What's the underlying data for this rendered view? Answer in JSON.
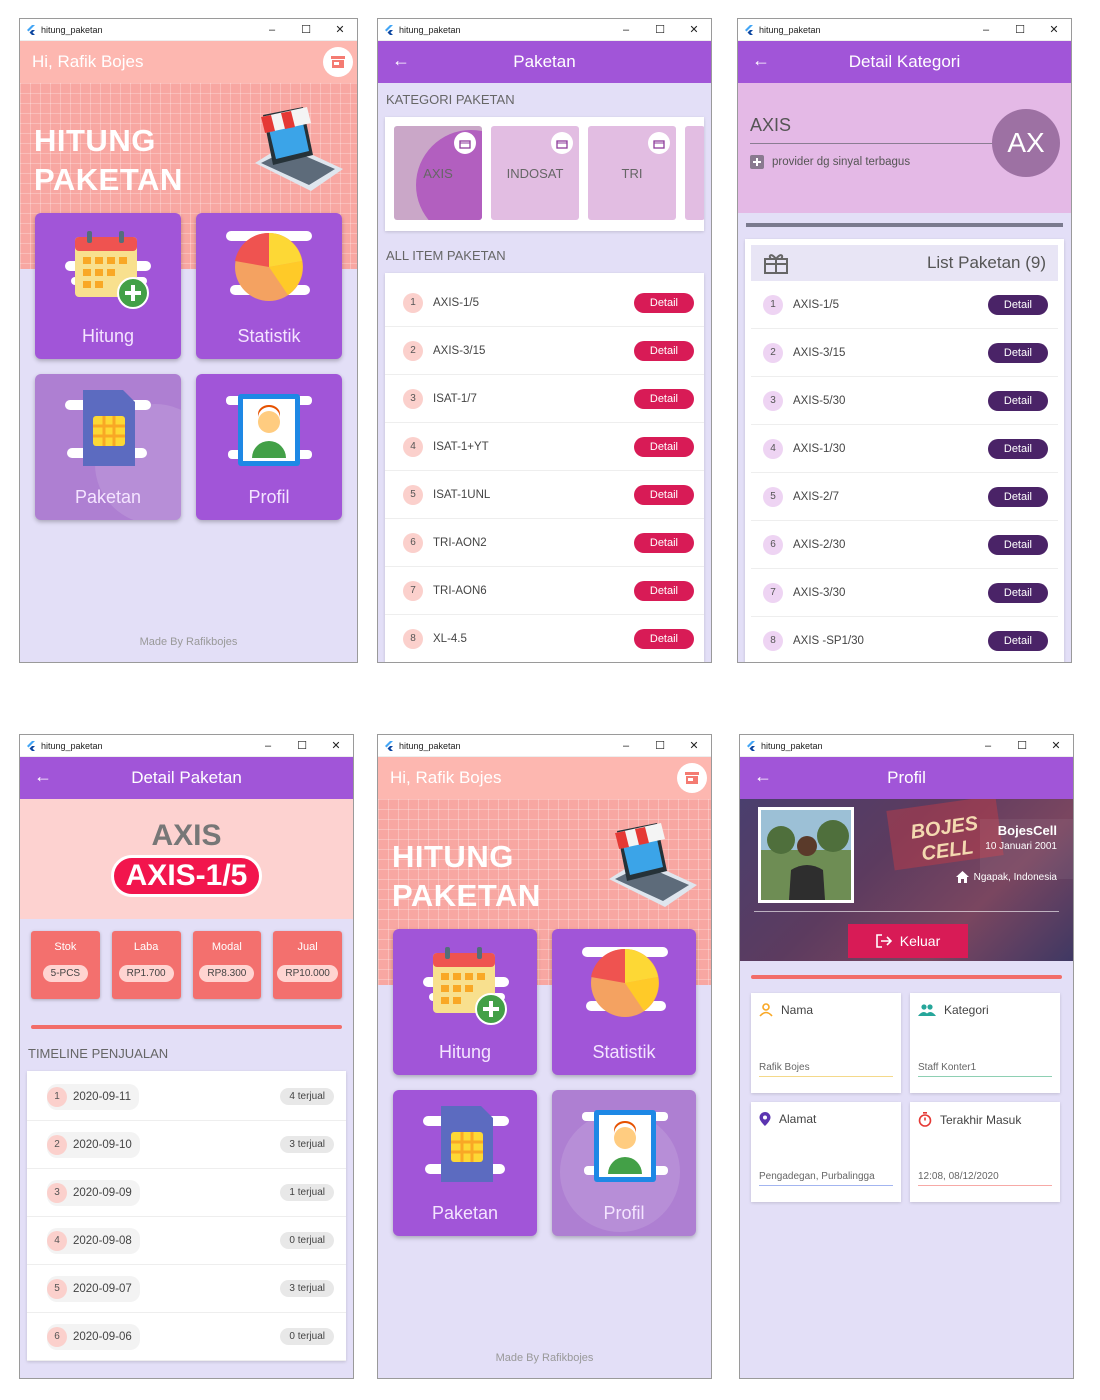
{
  "window": {
    "title": "hitung_paketan"
  },
  "home": {
    "greeting": "Hi, Rafik Bojes",
    "hero_line1": "HITUNG",
    "hero_line2": "PAKETAN",
    "tile_hitung": "Hitung",
    "tile_statistik": "Statistik",
    "tile_paketan": "Paketan",
    "tile_profil": "Profil",
    "made_by": "Made By Rafikbojes"
  },
  "paketan": {
    "title": "Paketan",
    "kategori_header": "KATEGORI PAKETAN",
    "categories": [
      "AXIS",
      "INDOSAT",
      "TRI"
    ],
    "items_header": "ALL ITEM PAKETAN",
    "items": [
      {
        "no": "1",
        "name": "AXIS-1/5"
      },
      {
        "no": "2",
        "name": "AXIS-3/15"
      },
      {
        "no": "3",
        "name": "ISAT-1/7"
      },
      {
        "no": "4",
        "name": "ISAT-1+YT"
      },
      {
        "no": "5",
        "name": "ISAT-1UNL"
      },
      {
        "no": "6",
        "name": "TRI-AON2"
      },
      {
        "no": "7",
        "name": "TRI-AON6"
      },
      {
        "no": "8",
        "name": "XL-4.5"
      }
    ],
    "detail_label": "Detail"
  },
  "kategori": {
    "title": "Detail Kategori",
    "name": "AXIS",
    "desc": "provider dg sinyal terbagus",
    "avatar": "AX",
    "list_title": "List Paketan (9)",
    "items": [
      {
        "no": "1",
        "name": "AXIS-1/5"
      },
      {
        "no": "2",
        "name": "AXIS-3/15"
      },
      {
        "no": "3",
        "name": "AXIS-5/30"
      },
      {
        "no": "4",
        "name": "AXIS-1/30"
      },
      {
        "no": "5",
        "name": "AXIS-2/7"
      },
      {
        "no": "6",
        "name": "AXIS-2/30"
      },
      {
        "no": "7",
        "name": "AXIS-3/30"
      },
      {
        "no": "8",
        "name": "AXIS -SP1/30"
      }
    ],
    "detail_label": "Detail"
  },
  "detail": {
    "title": "Detail Paketan",
    "provider": "AXIS",
    "product": "AXIS-1/5",
    "stats": [
      {
        "label": "Stok",
        "value": "5-PCS"
      },
      {
        "label": "Laba",
        "value": "RP1.700"
      },
      {
        "label": "Modal",
        "value": "RP8.300"
      },
      {
        "label": "Jual",
        "value": "RP10.000"
      }
    ],
    "timeline_header": "TIMELINE PENJUALAN",
    "timeline": [
      {
        "no": "1",
        "date": "2020-09-11",
        "sold": "4 terjual"
      },
      {
        "no": "2",
        "date": "2020-09-10",
        "sold": "3 terjual"
      },
      {
        "no": "3",
        "date": "2020-09-09",
        "sold": "1 terjual"
      },
      {
        "no": "4",
        "date": "2020-09-08",
        "sold": "0 terjual"
      },
      {
        "no": "5",
        "date": "2020-09-07",
        "sold": "3 terjual"
      },
      {
        "no": "6",
        "date": "2020-09-06",
        "sold": "0 terjual"
      }
    ]
  },
  "profil": {
    "title": "Profil",
    "shop": "BojesCell",
    "date": "10 Januari 2001",
    "location": "Ngapak, Indonesia",
    "logout": "Keluar",
    "sign_text": "BOJES CELL",
    "fields": [
      {
        "label": "Nama",
        "value": "Rafik Bojes"
      },
      {
        "label": "Kategori",
        "value": "Staff Konter1"
      },
      {
        "label": "Alamat",
        "value": "Pengadegan, Purbalingga"
      },
      {
        "label": "Terakhir Masuk",
        "value": "12:08, 08/12/2020"
      }
    ]
  },
  "colors": {
    "purple": "#a155d8",
    "pink": "#fdb7b0",
    "red": "#d81b56",
    "lavender": "#e3dff7"
  }
}
